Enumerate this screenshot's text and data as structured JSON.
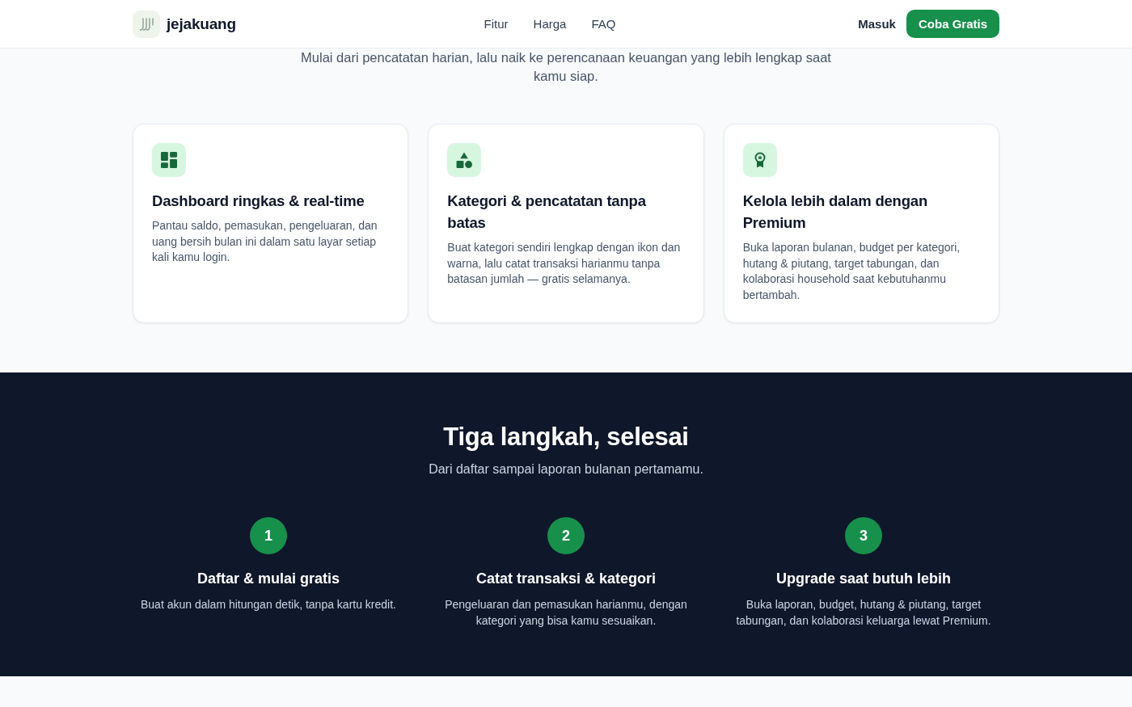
{
  "header": {
    "brand": "jejakuang",
    "nav": [
      {
        "label": "Fitur"
      },
      {
        "label": "Harga"
      },
      {
        "label": "FAQ"
      }
    ],
    "login": "Masuk",
    "cta": "Coba Gratis"
  },
  "features": {
    "subtitle": "Mulai dari pencatatan harian, lalu naik ke perencanaan keuangan yang lebih lengkap saat kamu siap.",
    "cards": [
      {
        "kind": "dashboard",
        "title": "Dashboard ringkas & real-time",
        "description": "Pantau saldo, pemasukan, pengeluaran, dan uang bersih bulan ini dalam satu layar setiap kali kamu login."
      },
      {
        "kind": "shapes",
        "title": "Kategori & pencatatan tanpa batas",
        "description": "Buat kategori sendiri lengkap dengan ikon dan warna, lalu catat transaksi harianmu tanpa batasan jumlah — gratis selamanya."
      },
      {
        "kind": "medal",
        "title": "Kelola lebih dalam dengan Premium",
        "description": "Buka laporan bulanan, budget per kategori, hutang & piutang, target tabungan, dan kolaborasi household saat kebutuhanmu bertambah."
      }
    ]
  },
  "steps": {
    "title": "Tiga langkah, selesai",
    "subtitle": "Dari daftar sampai laporan bulanan pertamamu.",
    "items": [
      {
        "number": "1",
        "title": "Daftar & mulai gratis",
        "description": "Buat akun dalam hitungan detik, tanpa kartu kredit."
      },
      {
        "number": "2",
        "title": "Catat transaksi & kategori",
        "description": "Pengeluaran dan pemasukan harianmu, dengan kategori yang bisa kamu sesuaikan."
      },
      {
        "number": "3",
        "title": "Upgrade saat butuh lebih",
        "description": "Buka laporan, budget, hutang & piutang, target tabungan, dan kolaborasi keluarga lewat Premium."
      }
    ]
  }
}
